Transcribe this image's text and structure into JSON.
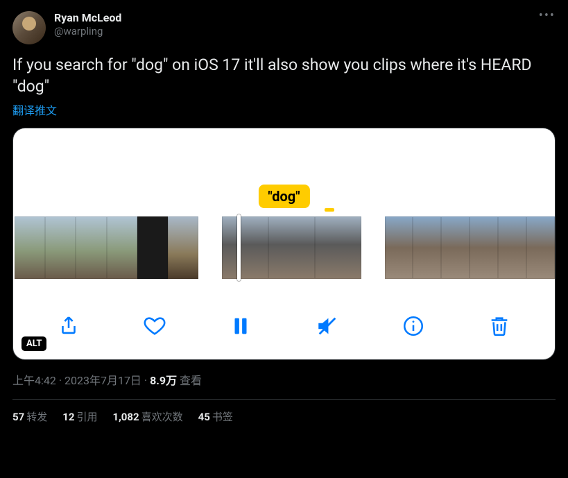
{
  "author": {
    "display_name": "Ryan McLeod",
    "handle": "@warpling"
  },
  "body_text": "If you search for \"dog\" on iOS 17 it'll also show you clips where it's HEARD \"dog\"",
  "translate_label": "翻译推文",
  "media": {
    "tooltip": "\"dog\"",
    "alt_badge": "ALT",
    "toolbar": {
      "share": "share",
      "like": "heart",
      "pause": "pause",
      "mute": "muted",
      "info": "info",
      "delete": "trash"
    }
  },
  "meta": {
    "time": "上午4:42",
    "dot1": " · ",
    "date": "2023年7月17日",
    "dot2": " · ",
    "views_num": "8.9万",
    "views_label": " 查看"
  },
  "stats": {
    "retweets_num": "57",
    "retweets_label": "转发",
    "quotes_num": "12",
    "quotes_label": "引用",
    "likes_num": "1,082",
    "likes_label": "喜欢次数",
    "bookmarks_num": "45",
    "bookmarks_label": "书签"
  }
}
